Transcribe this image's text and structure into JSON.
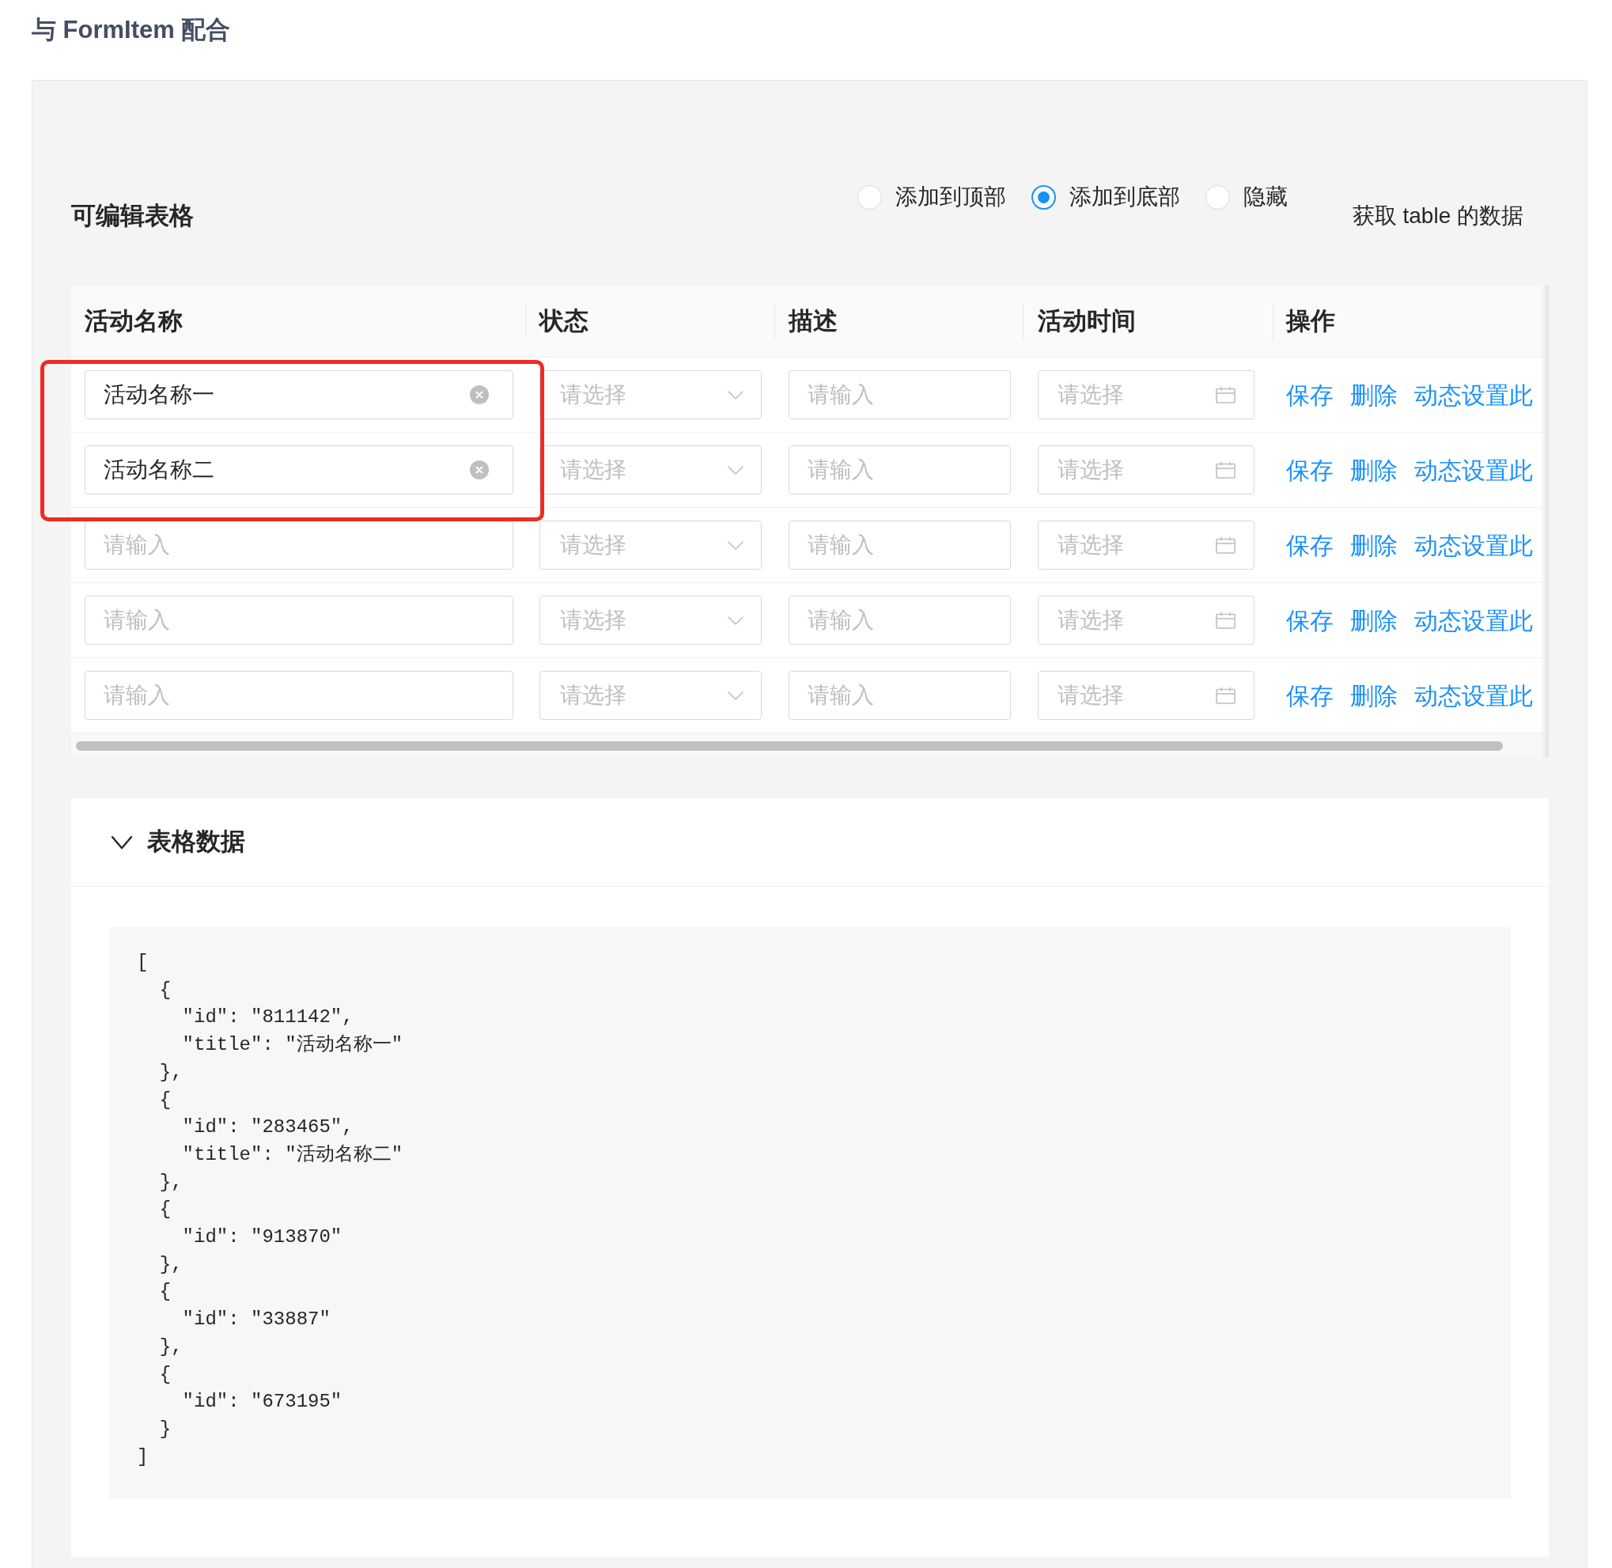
{
  "page": {
    "title": "与 FormItem 配合"
  },
  "toolbar": {
    "title": "可编辑表格",
    "position_options": [
      {
        "label": "添加到顶部",
        "selected": false
      },
      {
        "label": "添加到底部",
        "selected": true
      },
      {
        "label": "隐藏",
        "selected": false
      }
    ],
    "button": "获取 table 的数据"
  },
  "table": {
    "columns": [
      "活动名称",
      "状态",
      "描述",
      "活动时间",
      "操作"
    ],
    "rows": [
      {
        "highlighted": true,
        "cells": [
          {
            "kind": "input",
            "value": "活动名称一"
          },
          {
            "kind": "select",
            "placeholder": "请选择"
          },
          {
            "kind": "input",
            "placeholder": "请输入"
          },
          {
            "kind": "date",
            "placeholder": "请选择"
          },
          {
            "kind": "actions",
            "links": [
              "保存",
              "删除",
              "动态设置此"
            ]
          }
        ]
      },
      {
        "highlighted": true,
        "cells": [
          {
            "kind": "input",
            "value": "活动名称二"
          },
          {
            "kind": "select",
            "placeholder": "请选择"
          },
          {
            "kind": "input",
            "placeholder": "请输入"
          },
          {
            "kind": "date",
            "placeholder": "请选择"
          },
          {
            "kind": "actions",
            "links": [
              "保存",
              "删除",
              "动态设置此"
            ]
          }
        ]
      },
      {
        "highlighted": false,
        "cells": [
          {
            "kind": "input",
            "placeholder": "请输入"
          },
          {
            "kind": "select",
            "placeholder": "请选择"
          },
          {
            "kind": "input",
            "placeholder": "请输入"
          },
          {
            "kind": "date",
            "placeholder": "请选择"
          },
          {
            "kind": "actions",
            "links": [
              "保存",
              "删除",
              "动态设置此"
            ]
          }
        ]
      },
      {
        "highlighted": false,
        "cells": [
          {
            "kind": "input",
            "placeholder": "请输入"
          },
          {
            "kind": "select",
            "placeholder": "请选择"
          },
          {
            "kind": "input",
            "placeholder": "请输入"
          },
          {
            "kind": "date",
            "placeholder": "请选择"
          },
          {
            "kind": "actions",
            "links": [
              "保存",
              "删除",
              "动态设置此"
            ]
          }
        ]
      },
      {
        "highlighted": false,
        "cells": [
          {
            "kind": "input",
            "placeholder": "请输入"
          },
          {
            "kind": "select",
            "placeholder": "请选择"
          },
          {
            "kind": "input",
            "placeholder": "请输入"
          },
          {
            "kind": "date",
            "placeholder": "请选择"
          },
          {
            "kind": "actions",
            "links": [
              "保存",
              "删除",
              "动态设置此"
            ]
          }
        ]
      }
    ]
  },
  "data_panel": {
    "title": "表格数据",
    "expanded": true,
    "code": "[\n  {\n    \"id\": \"811142\",\n    \"title\": \"活动名称一\"\n  },\n  {\n    \"id\": \"283465\",\n    \"title\": \"活动名称二\"\n  },\n  {\n    \"id\": \"913870\"\n  },\n  {\n    \"id\": \"33887\"\n  },\n  {\n    \"id\": \"673195\"\n  }\n]"
  }
}
